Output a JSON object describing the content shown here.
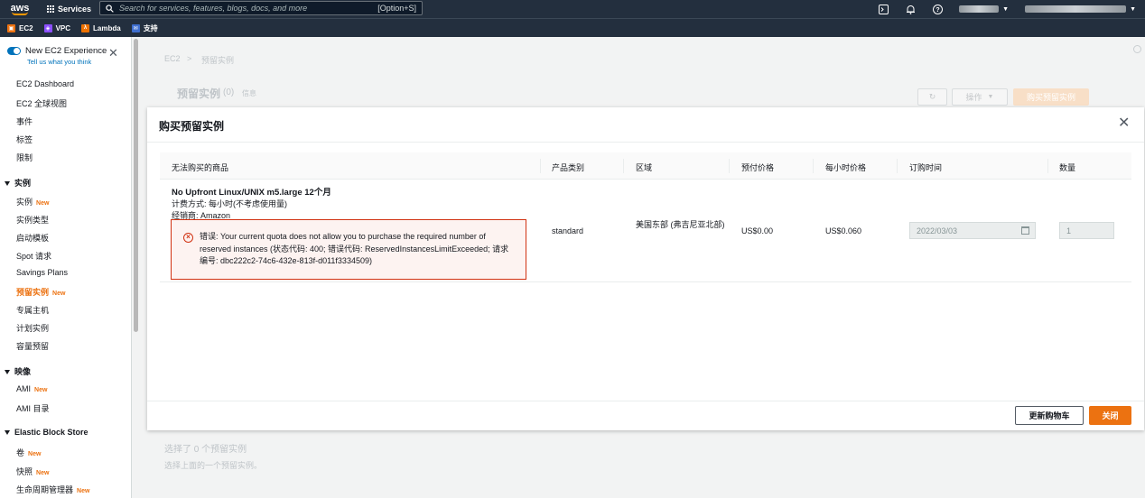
{
  "topnav": {
    "logo_text": "aws",
    "services_label": "Services",
    "search_placeholder": "Search for services, features, blogs, docs, and more",
    "search_shortcut": "[Option+S]"
  },
  "favorites": [
    {
      "label": "EC2",
      "color": "#ec7211",
      "icon": "ec2-icon"
    },
    {
      "label": "VPC",
      "color": "#8c4fff",
      "icon": "vpc-icon"
    },
    {
      "label": "Lambda",
      "color": "#ed7100",
      "icon": "lambda-icon"
    },
    {
      "label": "支持",
      "color": "#3f6fcf",
      "icon": "support-icon"
    }
  ],
  "sidebar": {
    "new_exp_title": "New EC2 Experience",
    "new_exp_sub": "Tell us what you think",
    "new_badge": "New",
    "items_top": [
      "EC2 Dashboard",
      "EC2 全球视图",
      "事件",
      "标签",
      "限制"
    ],
    "section_instances": "实例",
    "instances_items": [
      "实例",
      "实例类型",
      "启动模板",
      "Spot 请求",
      "Savings Plans",
      "预留实例",
      "专属主机",
      "计划实例",
      "容量预留"
    ],
    "section_images": "映像",
    "images_items": [
      "AMI",
      "AMI 目录"
    ],
    "section_ebs": "Elastic Block Store",
    "ebs_items": [
      "卷",
      "快照",
      "生命周期管理器"
    ]
  },
  "background": {
    "breadcrumb_root": "EC2",
    "breadcrumb_sep": ">",
    "breadcrumb_current": "预留实例",
    "page_title": "预留实例",
    "page_count": "(0)",
    "info_link": "信息",
    "actions_label": "操作",
    "purchase_label": "购买预留实例",
    "selected_text": "选择了 0 个预留实例",
    "selected_hint": "选择上面的一个预留实例。"
  },
  "modal": {
    "title": "购买预留实例",
    "columns": [
      "无法购买的商品",
      "产品类别",
      "区域",
      "预付价格",
      "每小时价格",
      "订购时间",
      "数量"
    ],
    "row": {
      "product_name": "No Upfront Linux/UNIX m5.large 12个月",
      "billing": "计费方式: 每小时(不考虑使用量)",
      "seller": "经销商: Amazon",
      "error": "错误: Your current quota does not allow you to purchase the required number of reserved instances (状态代码: 400; 错误代码: ReservedInstancesLimitExceeded; 请求编号: dbc222c2-74c6-432e-813f-d011f3334509)",
      "category": "standard",
      "region": "美国东部 (弗吉尼亚北部)",
      "upfront_price": "US$0.00",
      "hourly_price": "US$0.060",
      "order_date": "2022/03/03",
      "quantity": "1"
    },
    "update_cart_label": "更新购物车",
    "close_label": "关闭"
  }
}
